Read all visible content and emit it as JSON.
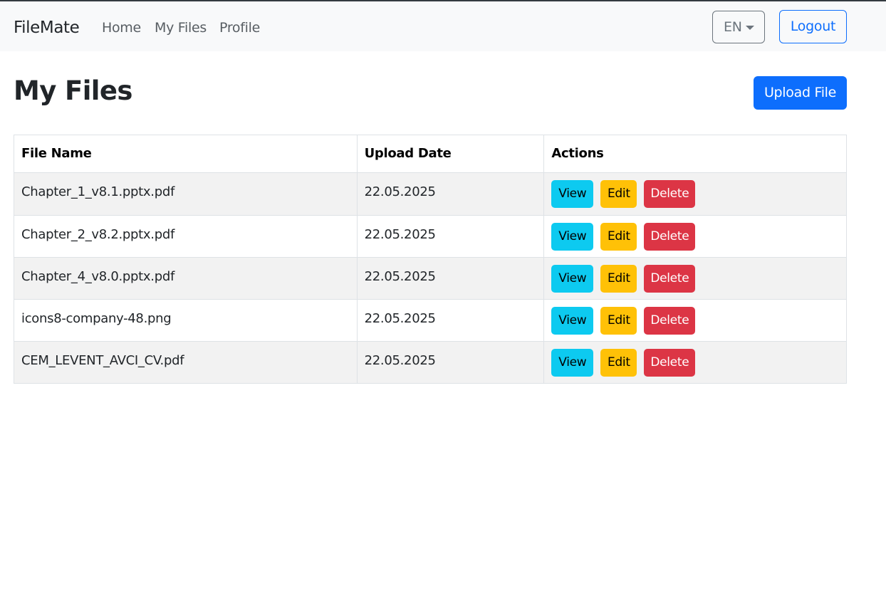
{
  "navbar": {
    "brand": "FileMate",
    "links": [
      "Home",
      "My Files",
      "Profile"
    ],
    "language": "EN",
    "logout_label": "Logout"
  },
  "page": {
    "title": "My Files",
    "upload_label": "Upload File"
  },
  "table": {
    "headers": [
      "File Name",
      "Upload Date",
      "Actions"
    ],
    "rows": [
      {
        "name": "Chapter_1_v8.1.pptx.pdf",
        "date": "22.05.2025"
      },
      {
        "name": "Chapter_2_v8.2.pptx.pdf",
        "date": "22.05.2025"
      },
      {
        "name": "Chapter_4_v8.0.pptx.pdf",
        "date": "22.05.2025"
      },
      {
        "name": "icons8-company-48.png",
        "date": "22.05.2025"
      },
      {
        "name": "CEM_LEVENT_AVCI_CV.pdf",
        "date": "22.05.2025"
      }
    ],
    "actions": {
      "view": "View",
      "edit": "Edit",
      "delete": "Delete"
    }
  },
  "colors": {
    "primary": "#0d6efd",
    "info": "#0dcaf0",
    "warning": "#ffc107",
    "danger": "#dc3545",
    "secondary": "#6c757d",
    "navbar_bg": "#f8f9fa"
  }
}
